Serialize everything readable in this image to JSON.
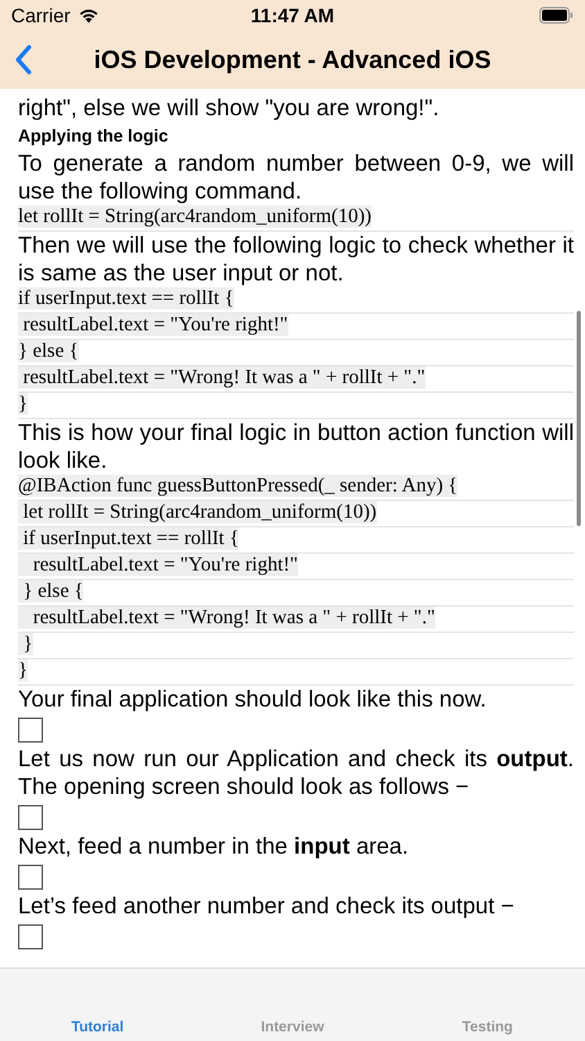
{
  "status_bar": {
    "carrier": "Carrier",
    "time": "11:47 AM"
  },
  "nav_bar": {
    "title": "iOS Development - Advanced iOS"
  },
  "content": [
    {
      "kind": "paragraph",
      "text": "right\", else we will show \"you are wrong!\"."
    },
    {
      "kind": "heading",
      "text": "Applying the logic"
    },
    {
      "kind": "paragraph",
      "text": "To generate a random number between 0-9, we will use the following command."
    },
    {
      "kind": "code",
      "lines": [
        "let rollIt = String(arc4random_uniform(10))"
      ]
    },
    {
      "kind": "paragraph",
      "text": "Then we will use the following logic to check whether it is same as the user input or not."
    },
    {
      "kind": "code",
      "lines": [
        "if userInput.text == rollIt {",
        " resultLabel.text = \"You're right!\"",
        "} else {",
        " resultLabel.text = \"Wrong! It was a \" + rollIt + \".\"",
        "}"
      ]
    },
    {
      "kind": "paragraph",
      "text": "This is how your final logic in button action function will look like."
    },
    {
      "kind": "code",
      "lines": [
        "@IBAction func guessButtonPressed(_ sender: Any) {",
        " let rollIt = String(arc4random_uniform(10))",
        " if userInput.text == rollIt {",
        "   resultLabel.text = \"You're right!\"",
        " } else {",
        "   resultLabel.text = \"Wrong! It was a \" + rollIt + \".\"",
        " }",
        "}"
      ]
    },
    {
      "kind": "paragraph",
      "text": "Your final application should look like this now."
    },
    {
      "kind": "image"
    },
    {
      "kind": "paragraph",
      "text": "Let us now run our Application and check its **output**. The opening screen should look as follows −"
    },
    {
      "kind": "image"
    },
    {
      "kind": "paragraph",
      "text": "Next, feed a number in the **input** area."
    },
    {
      "kind": "image"
    },
    {
      "kind": "paragraph",
      "text": "Let’s feed another number and check its output −"
    },
    {
      "kind": "image"
    }
  ],
  "tabs": [
    {
      "label": "Tutorial",
      "selected": true
    },
    {
      "label": "Interview",
      "selected": false
    },
    {
      "label": "Testing",
      "selected": false
    }
  ]
}
